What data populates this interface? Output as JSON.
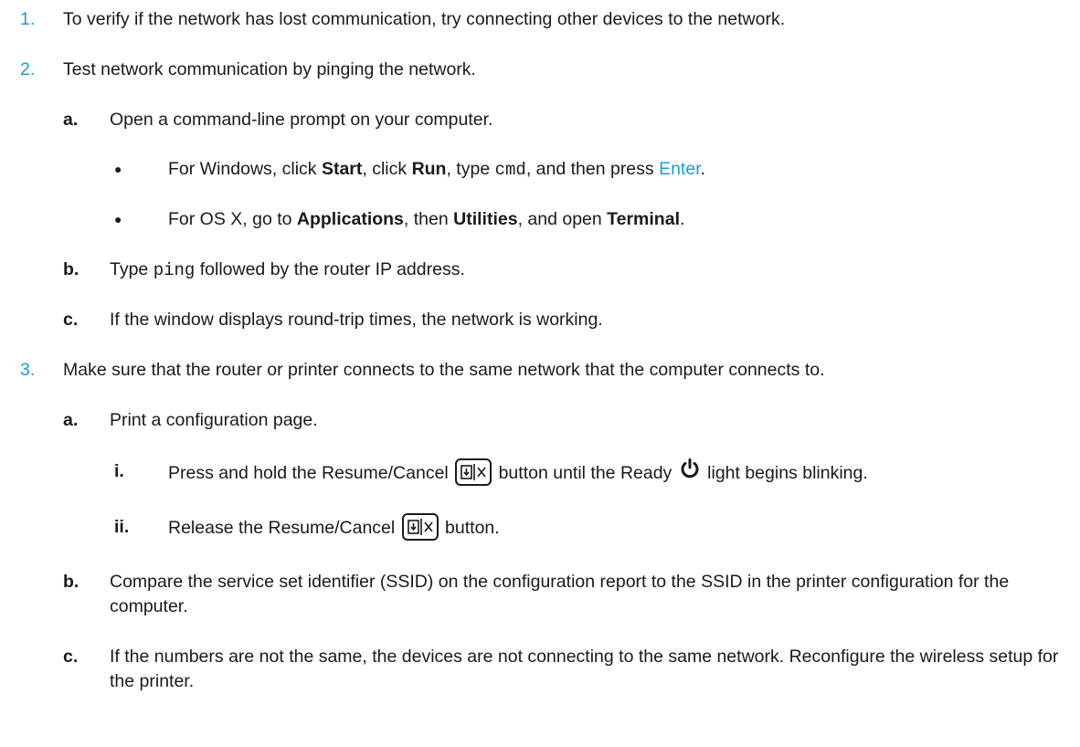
{
  "steps": [
    {
      "num": "1.",
      "text": "To verify if the network has lost communication, try connecting other devices to the network."
    },
    {
      "num": "2.",
      "text": "Test network communication by pinging the network.",
      "sub": [
        {
          "letter": "a.",
          "text": "Open a command-line prompt on your computer.",
          "bullets": [
            {
              "p1": "For Windows, click ",
              "start": "Start",
              "p2": ", click ",
              "run": "Run",
              "p3": ", type ",
              "cmd": "cmd",
              "p4": ", and then press ",
              "enter": "Enter",
              "p5": "."
            },
            {
              "p1": "For OS X, go to ",
              "apps": "Applications",
              "p2": ", then ",
              "utils": "Utilities",
              "p3": ", and open ",
              "terminal": "Terminal",
              "p4": "."
            }
          ]
        },
        {
          "letter": "b.",
          "p1": "Type ",
          "ping": "ping",
          "p2": " followed by the router IP address."
        },
        {
          "letter": "c.",
          "text": "If the window displays round-trip times, the network is working."
        }
      ]
    },
    {
      "num": "3.",
      "text": "Make sure that the router or printer connects to the same network that the computer connects to.",
      "sub": [
        {
          "letter": "a.",
          "text": "Print a configuration page.",
          "roman": [
            {
              "num": "i.",
              "p1": "Press and hold the Resume/Cancel ",
              "p2": " button until the Ready ",
              "p3": " light begins blinking."
            },
            {
              "num": "ii.",
              "p1": "Release the Resume/Cancel ",
              "p2": " button."
            }
          ]
        },
        {
          "letter": "b.",
          "text": "Compare the service set identifier (SSID) on the configuration report to the SSID in the printer configuration for the computer."
        },
        {
          "letter": "c.",
          "text": "If the numbers are not the same, the devices are not connecting to the same network. Reconfigure the wireless setup for the printer."
        }
      ]
    }
  ],
  "bullet_glyph": "●",
  "icons": {
    "resume_cancel": "resume-cancel-button-icon",
    "ready": "power-icon"
  },
  "colors": {
    "step_number": "#1d9bd6",
    "link": "#1d9bd6",
    "text": "#1a1a1a"
  }
}
